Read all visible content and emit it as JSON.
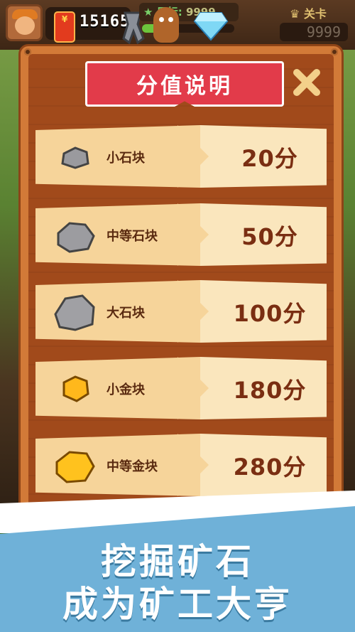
{
  "hud": {
    "red_packet_symbol": "¥",
    "coins": "15165",
    "target_label": "目标",
    "target_value": "9999",
    "target_progress": 0.18,
    "level_label": "关卡",
    "level_value": "9999"
  },
  "dialog": {
    "title": "分值说明",
    "close_icon": "close-x-icon",
    "rows": [
      {
        "icon": "small-stone-icon",
        "label": "小石块",
        "score": "20分"
      },
      {
        "icon": "medium-stone-icon",
        "label": "中等石块",
        "score": "50分"
      },
      {
        "icon": "large-stone-icon",
        "label": "大石块",
        "score": "100分"
      },
      {
        "icon": "small-gold-icon",
        "label": "小金块",
        "score": "180分"
      },
      {
        "icon": "medium-gold-icon",
        "label": "中等金块",
        "score": "280分"
      }
    ]
  },
  "banner": {
    "line1": "挖掘矿石",
    "line2": "成为矿工大亨"
  },
  "colors": {
    "board": "#d27a38",
    "ribbon": "#e23b4a",
    "row_left": "#f6d49a",
    "row_right": "#fae6bd",
    "score_text": "#7a2e12",
    "banner": "#6fb1d8"
  }
}
